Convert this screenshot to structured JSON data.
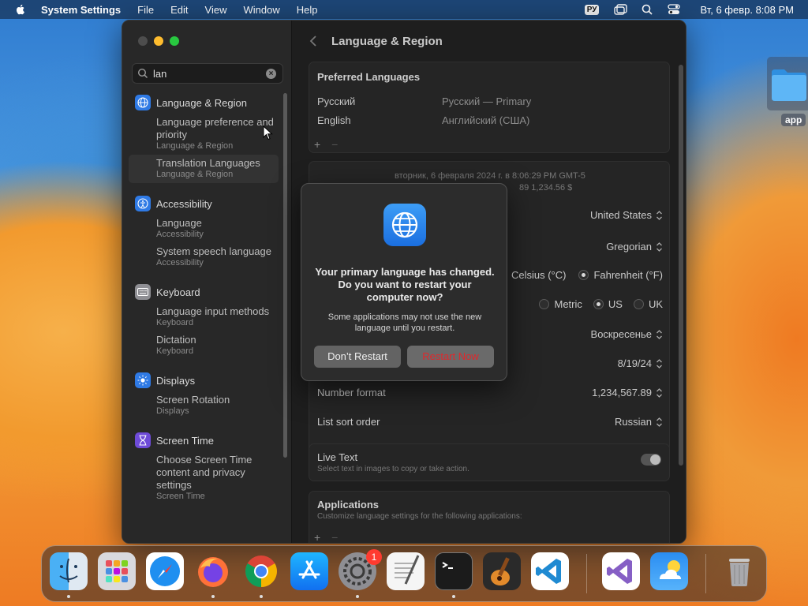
{
  "menubar": {
    "app_name": "System Settings",
    "menus": [
      "File",
      "Edit",
      "View",
      "Window",
      "Help"
    ],
    "input_source": "РУ",
    "clock": "Вт, 6 февр.  8:08 PM"
  },
  "desktop": {
    "folder_label": "app"
  },
  "window": {
    "search": {
      "value": "lan",
      "placeholder": "Search"
    },
    "sidebar": {
      "groups": [
        {
          "label": "Language & Region",
          "icon": "globe-icon",
          "color": "#2f7ae5",
          "items": [
            {
              "title": "Language preference and priority",
              "path": "Language & Region"
            },
            {
              "title": "Translation Languages",
              "path": "Language & Region"
            }
          ]
        },
        {
          "label": "Accessibility",
          "icon": "accessibility-icon",
          "color": "#2f7ae5",
          "items": [
            {
              "title": "Language",
              "path": "Accessibility"
            },
            {
              "title": "System speech language",
              "path": "Accessibility"
            }
          ]
        },
        {
          "label": "Keyboard",
          "icon": "keyboard-icon",
          "color": "#8e8e93",
          "items": [
            {
              "title": "Language input methods",
              "path": "Keyboard"
            },
            {
              "title": "Dictation",
              "path": "Keyboard"
            }
          ]
        },
        {
          "label": "Displays",
          "icon": "sun-icon",
          "color": "#2f7ae5",
          "items": [
            {
              "title": "Screen Rotation",
              "path": "Displays"
            }
          ]
        },
        {
          "label": "Screen Time",
          "icon": "hourglass-icon",
          "color": "#6e4bd8",
          "items": [
            {
              "title": "Choose Screen Time content and privacy settings",
              "path": "Screen Time"
            }
          ]
        }
      ]
    },
    "main": {
      "title": "Language & Region",
      "preferred_languages": {
        "title": "Preferred Languages",
        "rows": [
          {
            "name": "Русский",
            "detail": "Русский — Primary"
          },
          {
            "name": "English",
            "detail": "Английский (США)"
          }
        ],
        "add": "+",
        "remove": "−"
      },
      "preview": {
        "date": "вторник, 6 февраля 2024 г. в 8:06:29 PM GMT-5",
        "numbers": "89       1,234.56 $"
      },
      "settings": {
        "region": "United States",
        "calendar": "Gregorian",
        "temperature": {
          "options": [
            "Celsius (°C)",
            "Fahrenheit (°F)"
          ],
          "selected": 1
        },
        "measurement": {
          "options": [
            "Metric",
            "US",
            "UK"
          ],
          "selected": 1
        },
        "first_day": "Воскресенье",
        "date_format": "8/19/24",
        "number_format_label": "Number format",
        "number_format": "1,234,567.89",
        "list_sort_label": "List sort order",
        "list_sort": "Russian"
      },
      "live_text": {
        "title": "Live Text",
        "desc": "Select text in images to copy or take action.",
        "enabled": true
      },
      "applications": {
        "title": "Applications",
        "desc": "Customize language settings for the following applications:",
        "add": "+",
        "remove": "−"
      }
    }
  },
  "dialog": {
    "title": "Your primary language has changed. Do you want to restart your computer now?",
    "body": "Some applications may not use the new language until you restart.",
    "secondary_button": "Don’t Restart",
    "primary_button": "Restart Now"
  },
  "dock": {
    "apps": [
      {
        "name": "finder-icon",
        "running": true
      },
      {
        "name": "launchpad-icon",
        "running": false
      },
      {
        "name": "safari-icon",
        "running": false
      },
      {
        "name": "firefox-icon",
        "running": true
      },
      {
        "name": "chrome-icon",
        "running": true
      },
      {
        "name": "app-store-icon",
        "running": false
      },
      {
        "name": "system-settings-icon",
        "running": true,
        "badge": "1"
      },
      {
        "name": "textedit-icon",
        "running": false
      },
      {
        "name": "terminal-icon",
        "running": true
      },
      {
        "name": "garageband-icon",
        "running": false
      },
      {
        "name": "vscode-icon",
        "running": false
      },
      {
        "name": "visual-studio-icon",
        "running": false
      },
      {
        "name": "weather-icon",
        "running": false
      },
      {
        "name": "trash-icon",
        "running": false
      }
    ]
  }
}
